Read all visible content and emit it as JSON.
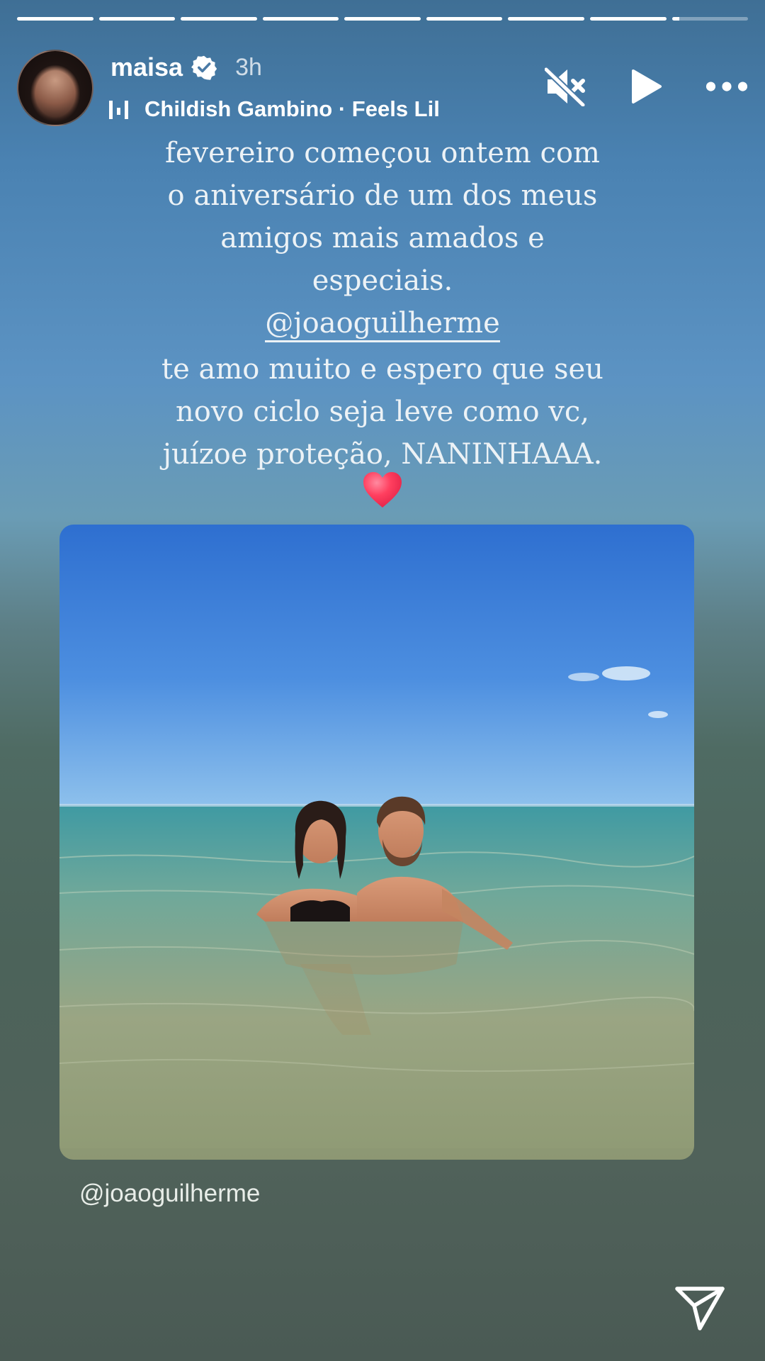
{
  "progress": {
    "segments": [
      1,
      1,
      1,
      1,
      1,
      1,
      1,
      1,
      0.1
    ]
  },
  "header": {
    "username": "maisa",
    "time": "3h",
    "music": {
      "artist": "Childish Gambino",
      "separator": " · ",
      "track": "Feels Lil"
    },
    "controls": {
      "mute_icon": "speaker-muted-icon",
      "play_icon": "play-icon",
      "more_icon": "more-dots-icon"
    }
  },
  "caption": {
    "line1": "fevereiro começou ontem com",
    "line2": "o aniversário de um dos meus",
    "line3": "amigos mais amados e",
    "line4": "especiais.",
    "mention": "@joaoguilherme",
    "line5": "te amo muito e espero que seu",
    "line6": "novo ciclo seja leve como vc,",
    "line7": "juízoe proteção, NANINHAAA."
  },
  "sticker": {
    "mention": "@joaoguilherme"
  },
  "colors": {
    "heart": "#ff3f5f",
    "verified": "#ffffff"
  }
}
